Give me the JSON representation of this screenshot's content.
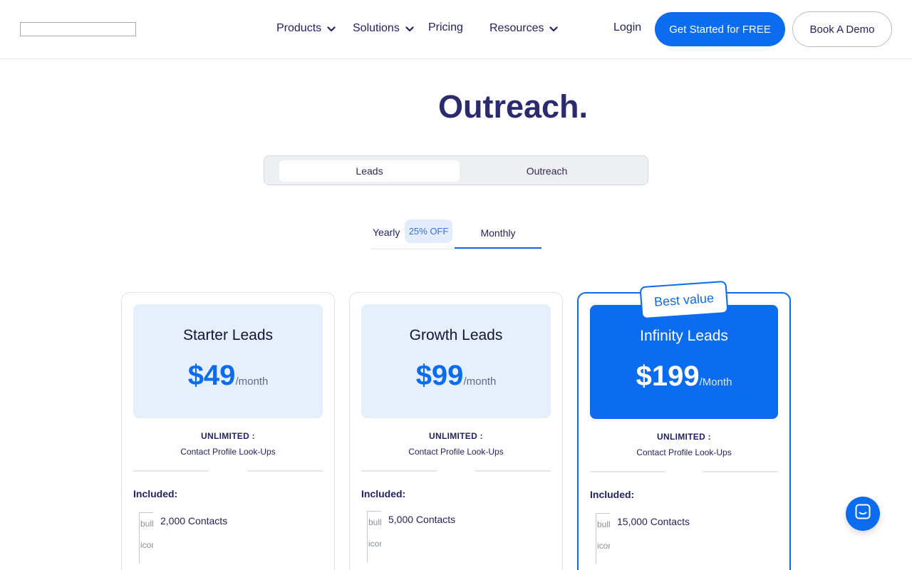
{
  "header": {
    "nav": {
      "products": "Products",
      "solutions": "Solutions",
      "pricing": "Pricing",
      "resources": "Resources"
    },
    "login": "Login",
    "cta_primary": "Get Started for FREE",
    "cta_secondary": "Book A Demo"
  },
  "hero": {
    "title": "Outreach."
  },
  "product_toggle": {
    "options": [
      "Leads",
      "Outreach"
    ],
    "selected": "Leads"
  },
  "billing": {
    "yearly_label": "Yearly",
    "discount": "25% OFF",
    "monthly_label": "Monthly",
    "selected": "Monthly"
  },
  "plans": [
    {
      "name": "Starter Leads",
      "price": "$49",
      "period": "/month",
      "unlimited": "UNLIMITED :",
      "lookups": "Contact Profile Look-Ups",
      "included_label": "Included:",
      "bullet_alt": "bullet icon",
      "contacts": "2,000 Contacts"
    },
    {
      "name": "Growth Leads",
      "price": "$99",
      "period": "/month",
      "unlimited": "UNLIMITED :",
      "lookups": "Contact Profile Look-Ups",
      "included_label": "Included:",
      "bullet_alt": "bullet icon",
      "contacts": "5,000 Contacts"
    },
    {
      "name": "Infinity Leads",
      "price": "$199",
      "period": "/Month",
      "unlimited": "UNLIMITED :",
      "lookups": "Contact Profile Look-Ups",
      "included_label": "Included:",
      "bullet_alt": "bullet icon",
      "contacts": "15,000 Contacts",
      "badge": "Best value"
    }
  ],
  "colors": {
    "accent": "#0b6cf0",
    "heading": "#2b2a6e",
    "card_tint": "#e6f0fd"
  },
  "icons": {
    "nav_chevron": "chevron-down-icon",
    "chat": "chat-icon"
  }
}
